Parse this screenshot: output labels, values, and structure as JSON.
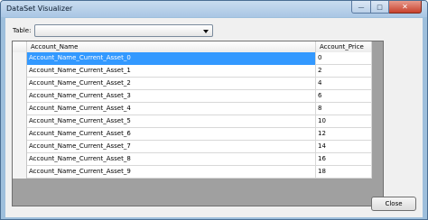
{
  "window": {
    "title": "DataSet Visualizer"
  },
  "table_selector": {
    "label": "Table:",
    "value": ""
  },
  "grid": {
    "columns": [
      "Account_Name",
      "Account_Price"
    ],
    "rows": [
      {
        "name": "Account_Name_Current_Asset_0",
        "price": "0"
      },
      {
        "name": "Account_Name_Current_Asset_1",
        "price": "2"
      },
      {
        "name": "Account_Name_Current_Asset_2",
        "price": "4"
      },
      {
        "name": "Account_Name_Current_Asset_3",
        "price": "6"
      },
      {
        "name": "Account_Name_Current_Asset_4",
        "price": "8"
      },
      {
        "name": "Account_Name_Current_Asset_5",
        "price": "10"
      },
      {
        "name": "Account_Name_Current_Asset_6",
        "price": "12"
      },
      {
        "name": "Account_Name_Current_Asset_7",
        "price": "14"
      },
      {
        "name": "Account_Name_Current_Asset_8",
        "price": "16"
      },
      {
        "name": "Account_Name_Current_Asset_9",
        "price": "18"
      }
    ],
    "selected_row": 0
  },
  "buttons": {
    "close_label": "Close"
  },
  "colors": {
    "selection": "#3399ff",
    "grid_background": "#a0a0a0"
  }
}
